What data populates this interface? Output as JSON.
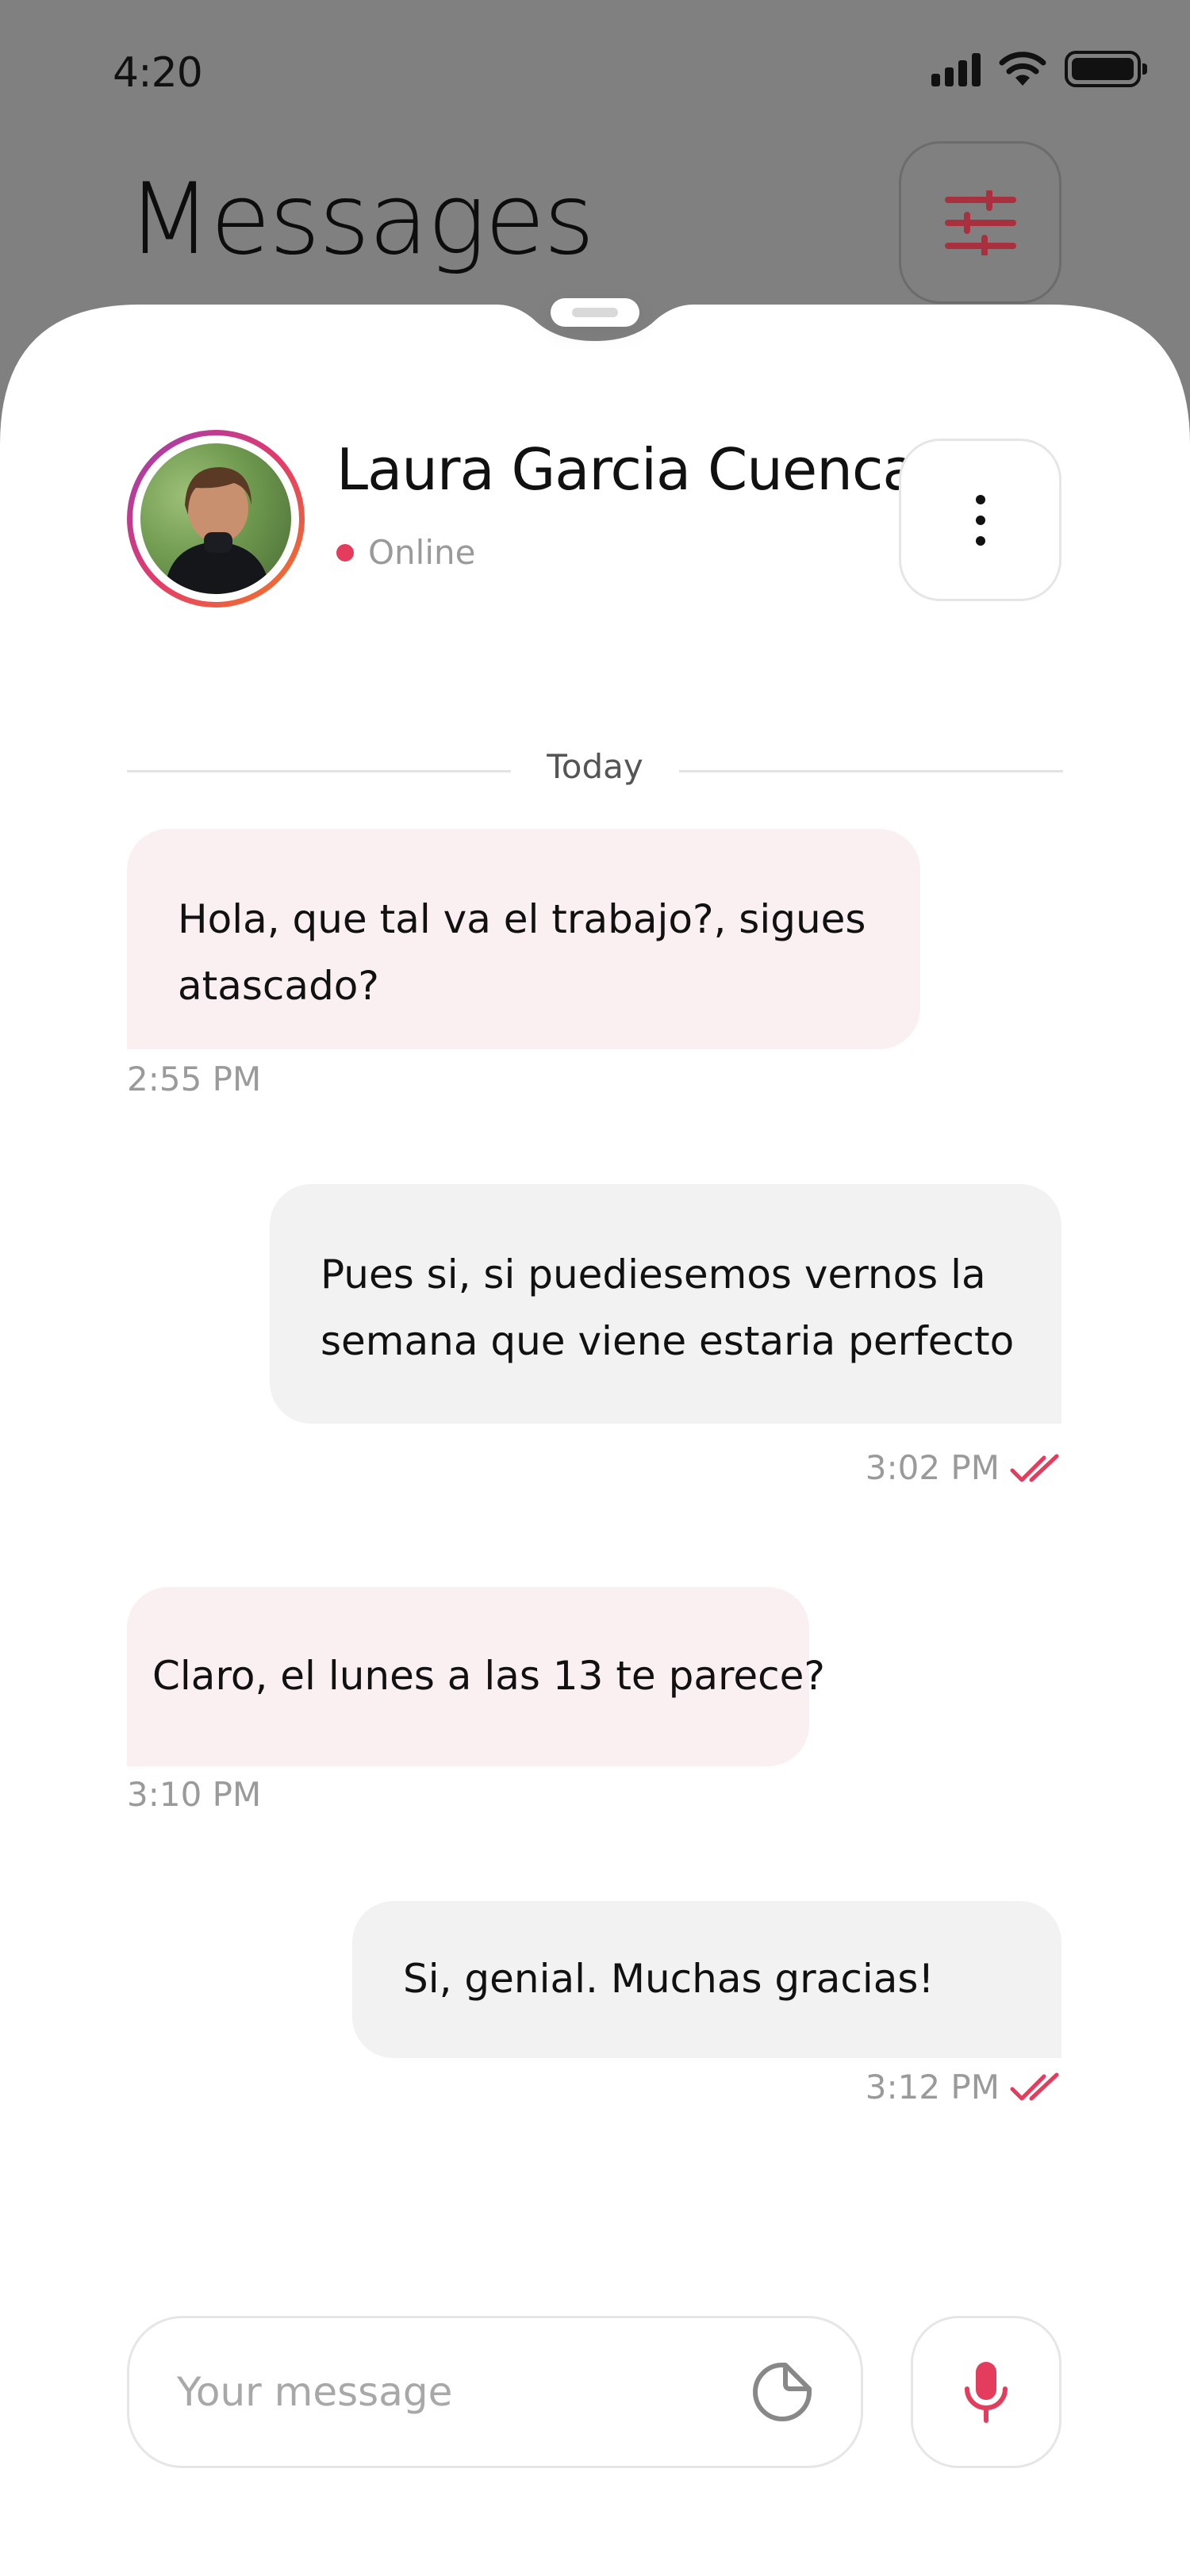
{
  "status_bar": {
    "time": "4:20"
  },
  "header": {
    "title": "Messages"
  },
  "contact": {
    "name": "Laura Garcia Cuenca",
    "status": "Online"
  },
  "conversation": {
    "date_label": "Today",
    "messages": [
      {
        "direction": "incoming",
        "lines": [
          "Hola, que tal va el trabajo?, sigues",
          "atascado?"
        ],
        "time": "2:55 PM"
      },
      {
        "direction": "outgoing",
        "lines": [
          "Pues si, si puediesemos vernos la",
          "semana que viene estaria perfecto"
        ],
        "time": "3:02 PM",
        "read": true
      },
      {
        "direction": "incoming",
        "lines": [
          "Claro, el lunes a las 13 te parece?"
        ],
        "time": "3:10 PM"
      },
      {
        "direction": "outgoing",
        "lines": [
          "Si, genial. Muchas gracias!"
        ],
        "time": "3:12 PM",
        "read": true
      }
    ]
  },
  "composer": {
    "placeholder": "Your message",
    "value": ""
  },
  "icons": {
    "filter": "sliders-icon",
    "more": "more-vertical-icon",
    "sticker": "sticker-icon",
    "mic": "microphone-icon",
    "read_receipt": "double-check-icon"
  },
  "colors": {
    "accent": "#e43c5c",
    "incoming_bubble": "#fbf0f1",
    "outgoing_bubble": "#f2f2f2",
    "header_background": "#808080"
  }
}
